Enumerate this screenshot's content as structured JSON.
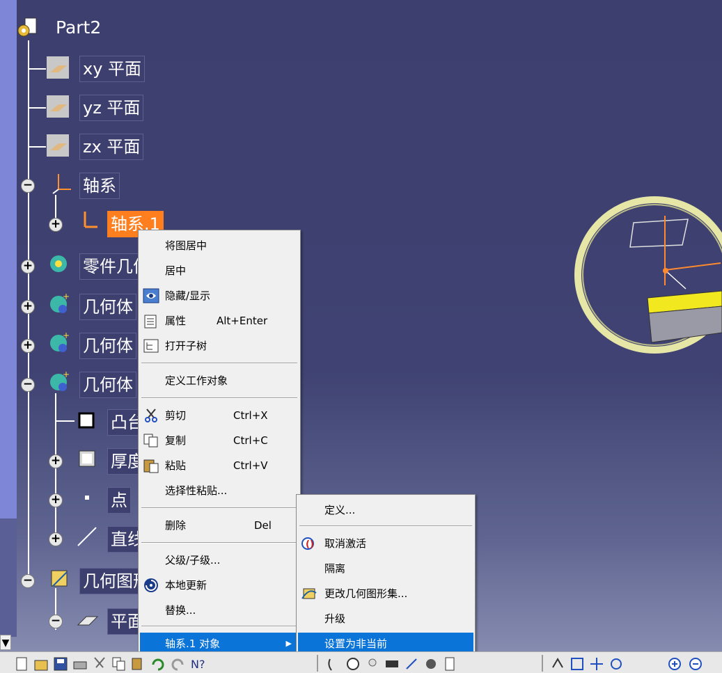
{
  "tree": {
    "root_label": "Part2",
    "planes": [
      "xy 平面",
      "yz 平面",
      "zx 平面"
    ],
    "axis_system_label": "轴系",
    "axis_system_1_label": "轴系.1",
    "part_body_label": "零件几何体",
    "geo_set_1_label": "几何体",
    "geo_set_2_label": "几何体",
    "geo_set_3_label": "几何体",
    "pad_label": "凸台",
    "thick_label": "厚度",
    "point_label": "点",
    "line_label": "直线",
    "geo_figure_set_label": "几何图形集",
    "plane_child_label": "平面"
  },
  "context_menu": {
    "items": [
      {
        "label": "将图居中"
      },
      {
        "label": "居中"
      },
      {
        "label": "隐藏/显示",
        "icon": "hide-show-icon"
      },
      {
        "label": "属性",
        "shortcut": "Alt+Enter",
        "icon": "properties-icon"
      },
      {
        "label": "打开子树",
        "icon": "open-subtree-icon"
      },
      {
        "label": "定义工作对象"
      },
      {
        "label": "剪切",
        "shortcut": "Ctrl+X",
        "icon": "scissors-icon"
      },
      {
        "label": "复制",
        "shortcut": "Ctrl+C",
        "icon": "copy-icon"
      },
      {
        "label": "粘贴",
        "shortcut": "Ctrl+V",
        "icon": "paste-icon"
      },
      {
        "label": "选择性粘贴..."
      },
      {
        "label": "删除",
        "shortcut": "Del"
      },
      {
        "label": "父级/子级..."
      },
      {
        "label": "本地更新",
        "icon": "local-update-icon"
      },
      {
        "label": "替换..."
      },
      {
        "label": "轴系.1 对象",
        "arrow": "▶"
      }
    ]
  },
  "sub_menu": {
    "items": [
      {
        "label": "定义..."
      },
      {
        "label": "取消激活",
        "icon": "deactivate-icon"
      },
      {
        "label": "隔离"
      },
      {
        "label": "更改几何图形集...",
        "icon": "change-geo-set-icon"
      },
      {
        "label": "升级"
      },
      {
        "label": "设置为非当前"
      }
    ]
  },
  "scroll": {
    "down_arrow": "▼"
  },
  "colors": {
    "background_top": "#3d3f6e",
    "selection": "#ff7f1f",
    "menu_highlight": "#0b74d8",
    "compass_ring": "#e8e8b0"
  }
}
